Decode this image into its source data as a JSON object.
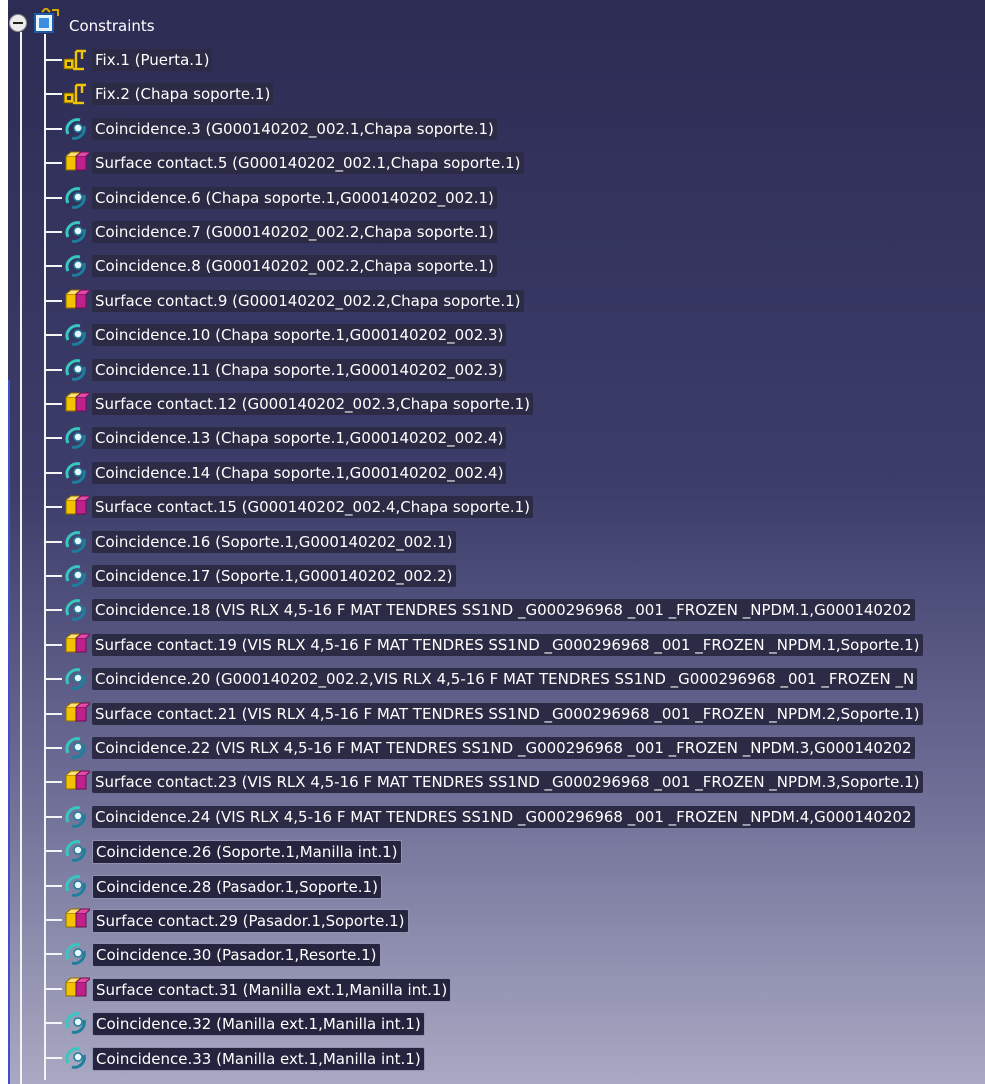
{
  "tree": {
    "root": {
      "label": "Constraints",
      "icon": "constraints-folder-icon"
    },
    "items": [
      {
        "label": "Fix.1 (Puerta.1)",
        "icon": "fix-anchor-icon",
        "kind": "fix"
      },
      {
        "label": "Fix.2 (Chapa soporte.1)",
        "icon": "fix-anchor-icon",
        "kind": "fix"
      },
      {
        "label": "Coincidence.3 (G000140202_002.1,Chapa soporte.1)",
        "icon": "coincidence-icon",
        "kind": "coincidence"
      },
      {
        "label": "Surface contact.5 (G000140202_002.1,Chapa soporte.1)",
        "icon": "surface-contact-icon",
        "kind": "surface"
      },
      {
        "label": "Coincidence.6 (Chapa soporte.1,G000140202_002.1)",
        "icon": "coincidence-icon",
        "kind": "coincidence"
      },
      {
        "label": "Coincidence.7 (G000140202_002.2,Chapa soporte.1)",
        "icon": "coincidence-icon",
        "kind": "coincidence"
      },
      {
        "label": "Coincidence.8 (G000140202_002.2,Chapa soporte.1)",
        "icon": "coincidence-icon",
        "kind": "coincidence"
      },
      {
        "label": "Surface contact.9 (G000140202_002.2,Chapa soporte.1)",
        "icon": "surface-contact-icon",
        "kind": "surface"
      },
      {
        "label": "Coincidence.10 (Chapa soporte.1,G000140202_002.3)",
        "icon": "coincidence-icon",
        "kind": "coincidence"
      },
      {
        "label": "Coincidence.11 (Chapa soporte.1,G000140202_002.3)",
        "icon": "coincidence-icon",
        "kind": "coincidence"
      },
      {
        "label": "Surface contact.12 (G000140202_002.3,Chapa soporte.1)",
        "icon": "surface-contact-icon",
        "kind": "surface"
      },
      {
        "label": "Coincidence.13 (Chapa soporte.1,G000140202_002.4)",
        "icon": "coincidence-icon",
        "kind": "coincidence"
      },
      {
        "label": "Coincidence.14 (Chapa soporte.1,G000140202_002.4)",
        "icon": "coincidence-icon",
        "kind": "coincidence"
      },
      {
        "label": "Surface contact.15 (G000140202_002.4,Chapa soporte.1)",
        "icon": "surface-contact-icon",
        "kind": "surface"
      },
      {
        "label": "Coincidence.16 (Soporte.1,G000140202_002.1)",
        "icon": "coincidence-icon",
        "kind": "coincidence"
      },
      {
        "label": "Coincidence.17 (Soporte.1,G000140202_002.2)",
        "icon": "coincidence-icon",
        "kind": "coincidence"
      },
      {
        "label": "Coincidence.18 (VIS RLX 4,5-16 F MAT TENDRES SS1ND _G000296968 _001 _FROZEN _NPDM.1,G000140202",
        "icon": "coincidence-icon",
        "kind": "coincidence"
      },
      {
        "label": "Surface contact.19 (VIS RLX 4,5-16 F MAT TENDRES SS1ND _G000296968 _001 _FROZEN _NPDM.1,Soporte.1)",
        "icon": "surface-contact-icon",
        "kind": "surface"
      },
      {
        "label": "Coincidence.20 (G000140202_002.2,VIS RLX 4,5-16 F MAT TENDRES SS1ND _G000296968 _001 _FROZEN _N",
        "icon": "coincidence-icon",
        "kind": "coincidence"
      },
      {
        "label": "Surface contact.21 (VIS RLX 4,5-16 F MAT TENDRES SS1ND _G000296968 _001 _FROZEN _NPDM.2,Soporte.1)",
        "icon": "surface-contact-icon",
        "kind": "surface"
      },
      {
        "label": "Coincidence.22 (VIS RLX 4,5-16 F MAT TENDRES SS1ND _G000296968 _001 _FROZEN _NPDM.3,G000140202",
        "icon": "coincidence-icon",
        "kind": "coincidence"
      },
      {
        "label": "Surface contact.23 (VIS RLX 4,5-16 F MAT TENDRES SS1ND _G000296968 _001 _FROZEN _NPDM.3,Soporte.1)",
        "icon": "surface-contact-icon",
        "kind": "surface"
      },
      {
        "label": "Coincidence.24 (VIS RLX 4,5-16 F MAT TENDRES SS1ND _G000296968 _001 _FROZEN _NPDM.4,G000140202",
        "icon": "coincidence-icon",
        "kind": "coincidence"
      },
      {
        "label": "Coincidence.26 (Soporte.1,Manilla int.1)",
        "icon": "coincidence-icon",
        "kind": "coincidence"
      },
      {
        "label": "Coincidence.28 (Pasador.1,Soporte.1)",
        "icon": "coincidence-icon",
        "kind": "coincidence"
      },
      {
        "label": "Surface contact.29 (Pasador.1,Soporte.1)",
        "icon": "surface-contact-icon",
        "kind": "surface"
      },
      {
        "label": "Coincidence.30 (Pasador.1,Resorte.1)",
        "icon": "coincidence-icon",
        "kind": "coincidence"
      },
      {
        "label": "Surface contact.31 (Manilla ext.1,Manilla int.1)",
        "icon": "surface-contact-icon",
        "kind": "surface"
      },
      {
        "label": "Coincidence.32 (Manilla ext.1,Manilla int.1)",
        "icon": "coincidence-icon",
        "kind": "coincidence"
      },
      {
        "label": "Coincidence.33 (Manilla ext.1,Manilla int.1)",
        "icon": "coincidence-icon",
        "kind": "coincidence"
      }
    ]
  },
  "colors": {
    "background_top": "#2c2c54",
    "background_bottom": "#a9a9c3",
    "tree_line": "#f4f4f4",
    "label_text": "#ffffff",
    "label_highlight": "#2b2b45"
  }
}
